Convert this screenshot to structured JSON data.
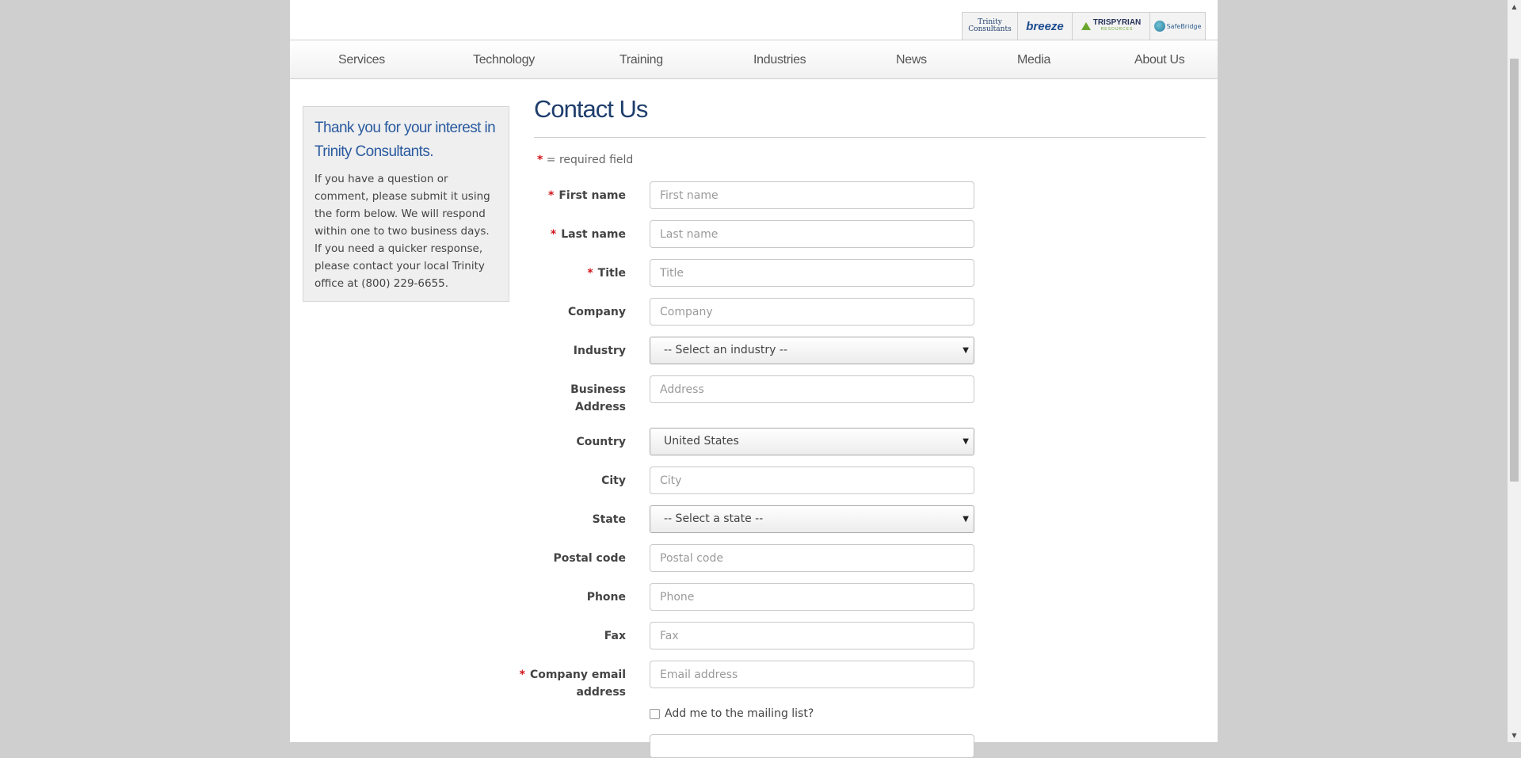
{
  "brands": [
    {
      "name": "Trinity Consultants",
      "icon": "trinity-logo"
    },
    {
      "name": "breeze",
      "icon": "breeze-logo"
    },
    {
      "name": "TRISPYRIAN",
      "sub": "RESOURCES",
      "icon": "trispyrian-logo"
    },
    {
      "name": "SafeBridge",
      "icon": "safebridge-logo"
    }
  ],
  "nav": [
    "Services",
    "Technology",
    "Training",
    "Industries",
    "News",
    "Media",
    "About Us"
  ],
  "sidebar": {
    "heading": "Thank you for your interest in Trinity Consultants.",
    "body": "If you have a question or comment, please submit it using the form below. We will respond within one to two business days. If you need a quicker response, please contact your local Trinity office at (800) 229-6655."
  },
  "page_title": "Contact Us",
  "required_note": "= required field",
  "form": {
    "first_name": {
      "label": "First name",
      "placeholder": "First name"
    },
    "last_name": {
      "label": "Last name",
      "placeholder": "Last name"
    },
    "title": {
      "label": "Title",
      "placeholder": "Title"
    },
    "company": {
      "label": "Company",
      "placeholder": "Company"
    },
    "industry": {
      "label": "Industry",
      "value": "-- Select an industry --"
    },
    "address": {
      "label_line1": "Business",
      "label_line2": "Address",
      "placeholder": "Address"
    },
    "country": {
      "label": "Country",
      "value": "United States"
    },
    "city": {
      "label": "City",
      "placeholder": "City"
    },
    "state": {
      "label": "State",
      "value": "-- Select a state --"
    },
    "postal": {
      "label": "Postal code",
      "placeholder": "Postal code"
    },
    "phone": {
      "label": "Phone",
      "placeholder": "Phone"
    },
    "fax": {
      "label": "Fax",
      "placeholder": "Fax"
    },
    "email": {
      "label_line1": "Company email",
      "label_line2": "address",
      "placeholder": "Email address"
    },
    "mailing_list": "Add me to the mailing list?"
  }
}
